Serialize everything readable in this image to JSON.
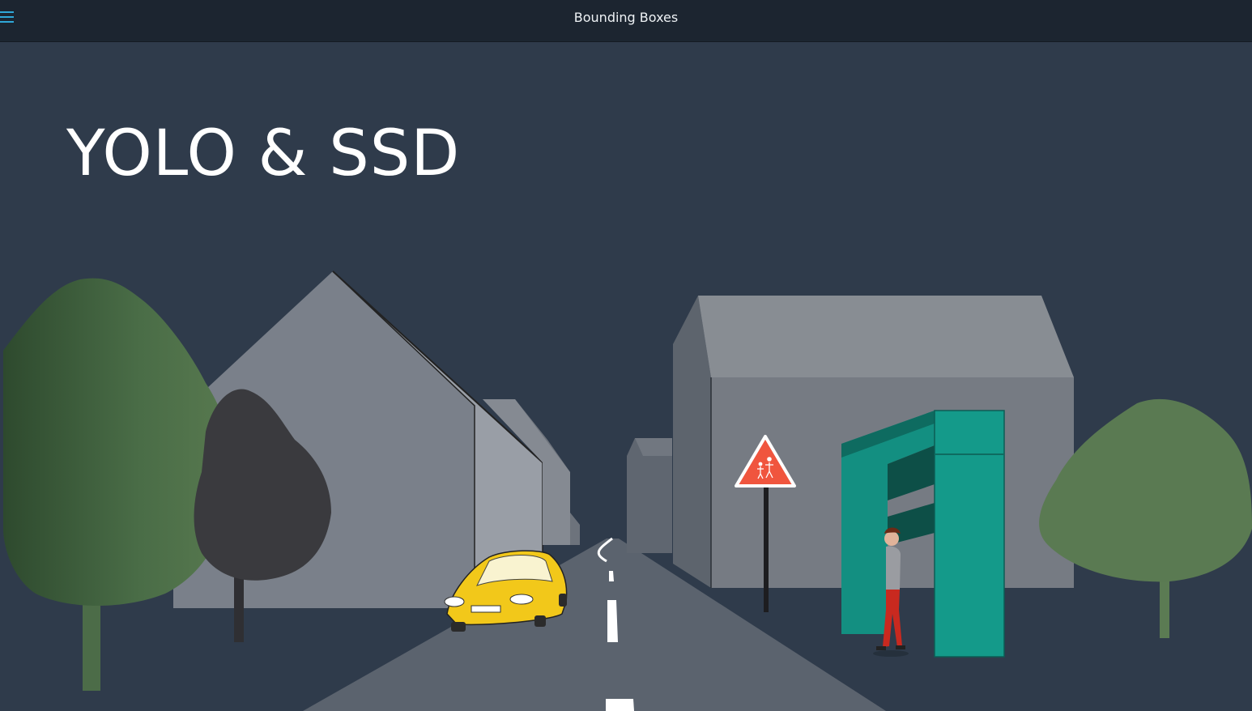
{
  "header": {
    "title": "Bounding Boxes",
    "menu_icon": "hamburger-menu-icon"
  },
  "slide": {
    "heading": "YOLO & SSD",
    "illustration": "street-scene",
    "background_color": "#2f3b4b"
  },
  "colors": {
    "accent": "#2fa8d8",
    "car": "#f2c81a",
    "bus_stop": "#149a8a",
    "sign": "#f0553e",
    "tree": "#4c6e49"
  }
}
